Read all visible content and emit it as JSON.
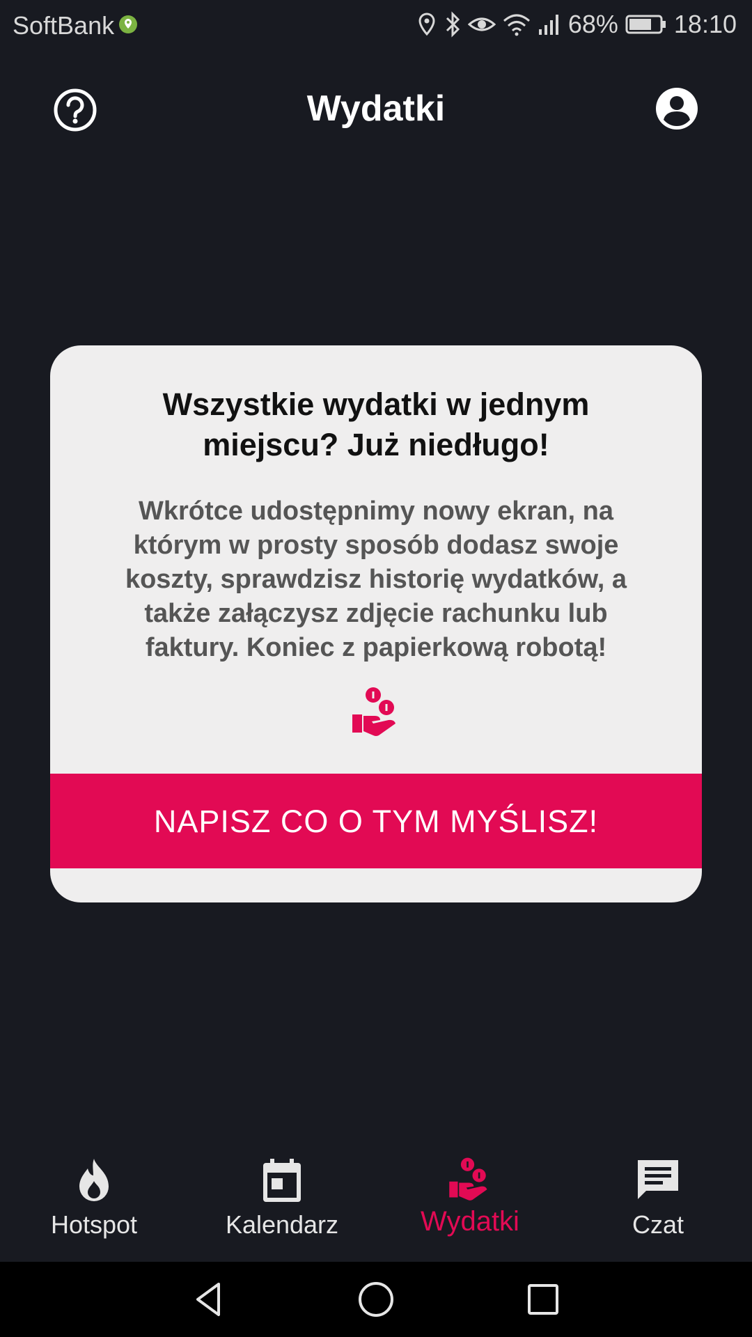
{
  "status_bar": {
    "carrier": "SoftBank",
    "battery": "68%",
    "time": "18:10"
  },
  "header": {
    "title": "Wydatki",
    "help_icon": "help-circle-icon",
    "profile_icon": "account-circle-icon"
  },
  "card": {
    "title": "Wszystkie wydatki w jednym miejscu? Już niedługo!",
    "body": "Wkrótce udostępnimy nowy ekran, na którym w prosty sposób dodasz swoje koszty, sprawdzisz historię wydatków, a także załączysz zdjęcie rachunku lub faktury. Koniec z papierkową robotą!",
    "icon": "hand-coins-icon",
    "button_label": "NAPISZ CO O TYM MYŚLISZ!"
  },
  "bottom_nav": {
    "items": [
      {
        "label": "Hotspot",
        "icon": "flame-icon",
        "active": false
      },
      {
        "label": "Kalendarz",
        "icon": "calendar-icon",
        "active": false
      },
      {
        "label": "Wydatki",
        "icon": "hand-coins-icon",
        "active": true
      },
      {
        "label": "Czat",
        "icon": "chat-icon",
        "active": false
      }
    ]
  },
  "colors": {
    "background": "#181a21",
    "card": "#efeeee",
    "accent": "#e20a54",
    "text_primary": "#ffffff",
    "nav_inactive": "#e6e6e6"
  }
}
